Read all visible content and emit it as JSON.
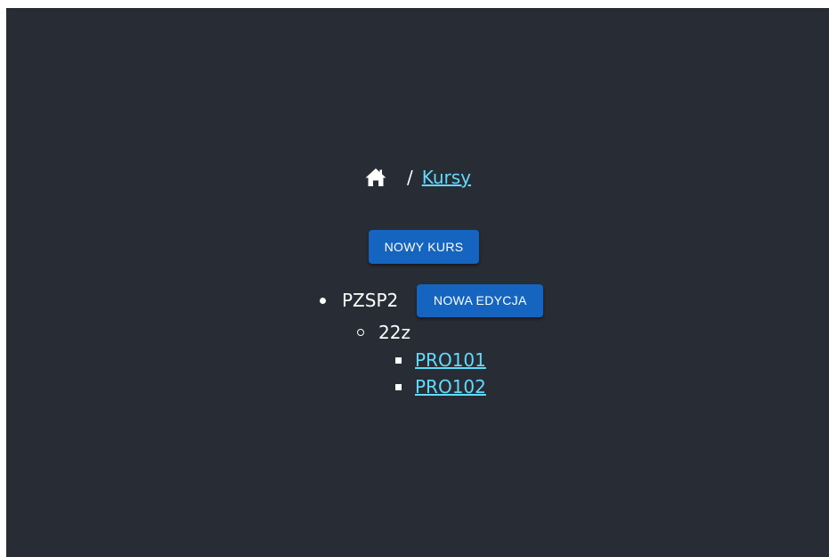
{
  "breadcrumb": {
    "home_icon": "home-icon",
    "separator": "/",
    "current_label": "Kursy"
  },
  "toolbar": {
    "new_course_label": "NOWY KURS"
  },
  "courses": [
    {
      "name": "PZSP2",
      "new_edition_label": "NOWA EDYCJA",
      "editions": [
        {
          "name": "22z",
          "groups": [
            "PRO101",
            "PRO102"
          ]
        }
      ]
    }
  ],
  "colors": {
    "background": "#282c34",
    "link": "#61dafb",
    "button": "#1565c0",
    "text": "#ffffff"
  }
}
